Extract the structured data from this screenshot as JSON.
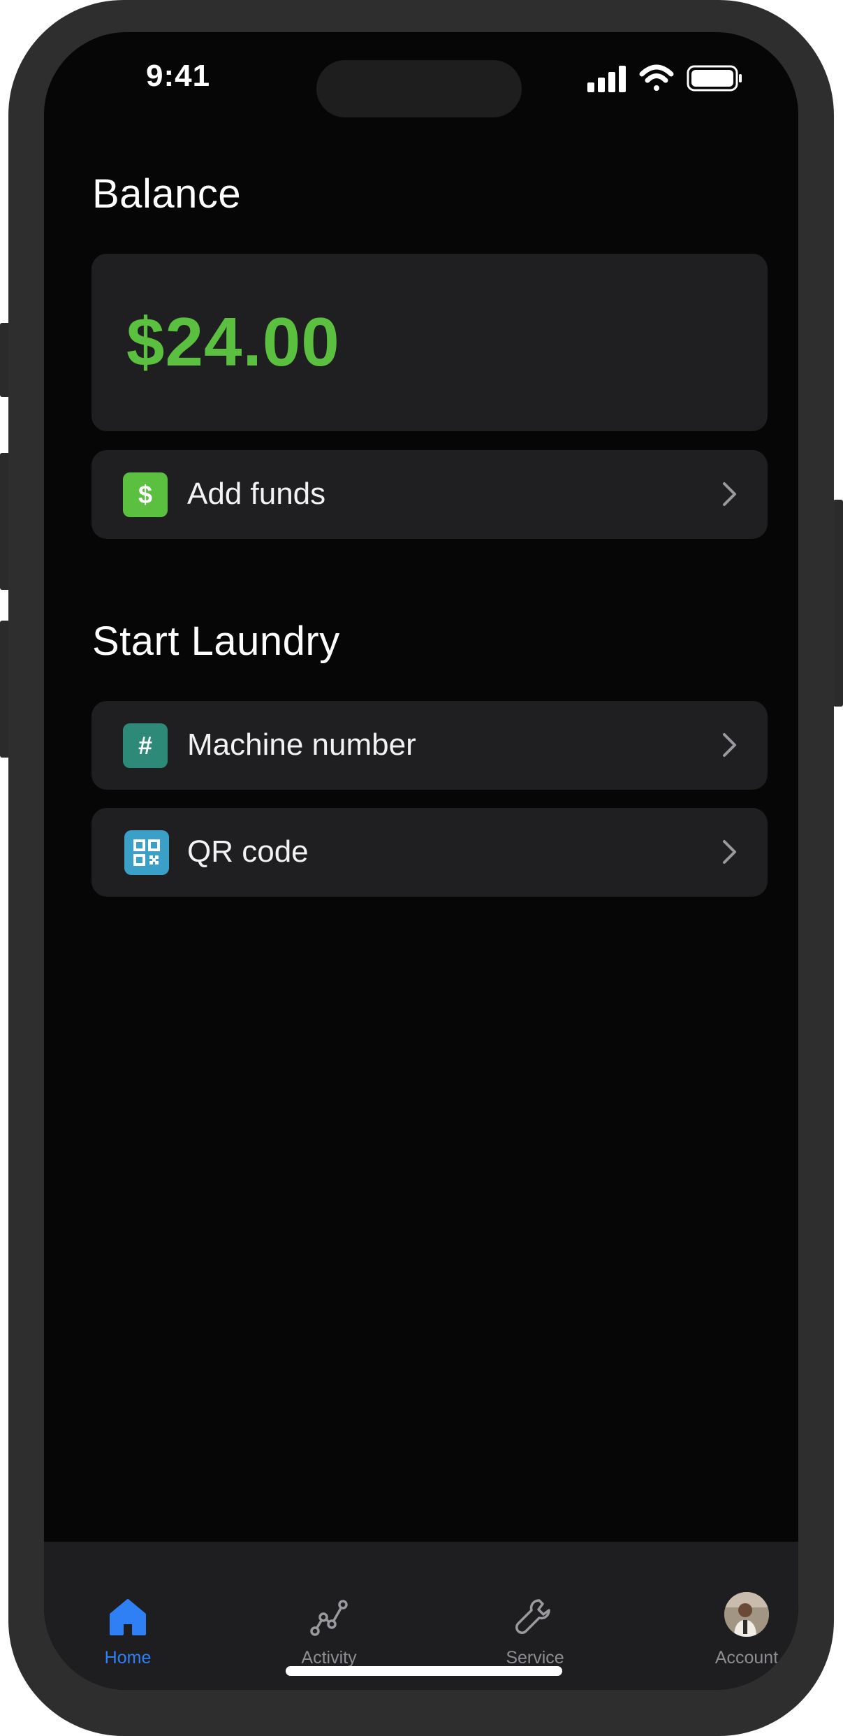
{
  "status_bar": {
    "time": "9:41"
  },
  "balance": {
    "title": "Balance",
    "amount": "$24.00"
  },
  "add_funds": {
    "icon_glyph": "$",
    "label": "Add funds"
  },
  "start_laundry": {
    "title": "Start Laundry",
    "items": [
      {
        "icon": "hash-icon",
        "icon_glyph": "#",
        "label": "Machine number"
      },
      {
        "icon": "qr-code-icon",
        "label": "QR code"
      }
    ]
  },
  "tabs": [
    {
      "label": "Home",
      "icon": "home-icon",
      "active": true
    },
    {
      "label": "Activity",
      "icon": "activity-icon",
      "active": false
    },
    {
      "label": "Service",
      "icon": "wrench-icon",
      "active": false
    },
    {
      "label": "Account",
      "icon": "avatar",
      "active": false
    }
  ],
  "colors": {
    "accent_green": "#5bc040",
    "active_tab": "#2f7ff5",
    "hash_icon_bg": "#2e8a78",
    "qr_icon_bg": "#3aa0c8"
  }
}
